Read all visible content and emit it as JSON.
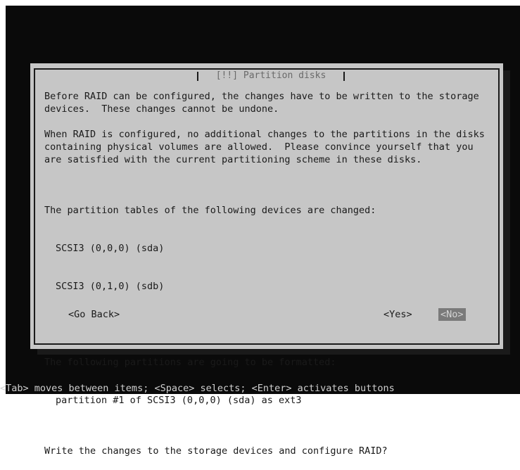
{
  "dialog": {
    "title": " [!!] Partition disks ",
    "paragraphs": {
      "p1": "Before RAID can be configured, the changes have to be written to the storage devices.  These changes cannot be undone.",
      "p2": "When RAID is configured, no additional changes to the partitions in the disks containing physical volumes are allowed.  Please convince yourself that you are satisfied with the current partitioning scheme in these disks.",
      "p3_heading": "The partition tables of the following devices are changed:",
      "devices": [
        "SCSI3 (0,0,0) (sda)",
        "SCSI3 (0,1,0) (sdb)"
      ],
      "p4_heading": "The following partitions are going to be formatted:",
      "partitions": [
        "partition #1 of SCSI3 (0,0,0) (sda) as ext3"
      ],
      "question": "Write the changes to the storage devices and configure RAID?"
    },
    "buttons": {
      "go_back": "<Go Back>",
      "yes": "<Yes>",
      "no": "<No>"
    }
  },
  "help_line": "<Tab> moves between items; <Space> selects; <Enter> activates buttons"
}
